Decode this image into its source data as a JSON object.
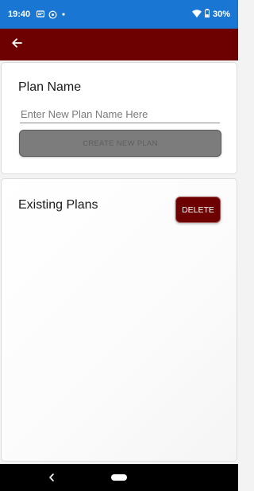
{
  "status_bar": {
    "time": "19:40",
    "battery_text": "30%",
    "icons": [
      "message-icon",
      "whatsapp-icon",
      "dot-icon",
      "wifi-icon",
      "battery-icon"
    ]
  },
  "app_bar": {
    "color": "#6d0000",
    "back_icon": "arrow-left-icon"
  },
  "plan_card": {
    "label": "Plan Name",
    "input_value": "",
    "input_placeholder": "Enter New Plan Name Here",
    "create_button_label": "CREATE NEW PLAN"
  },
  "existing_card": {
    "label": "Existing Plans",
    "delete_button_label": "DELETE"
  },
  "nav_bar": {
    "icons": [
      "nav-back-icon",
      "nav-home-pill-icon"
    ]
  },
  "colors": {
    "status_bar": "#1976d2",
    "app_bar": "#6d0000",
    "delete_button": "#6d0000",
    "create_button_disabled": "#7c7c7c"
  }
}
